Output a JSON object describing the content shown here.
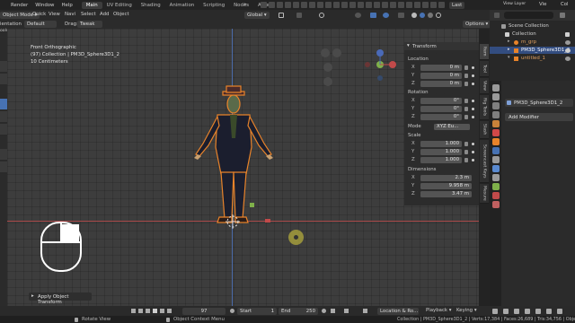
{
  "topbar": {
    "menus": [
      "Render",
      "Window",
      "Help"
    ],
    "workspaces": [
      "Main",
      "UV Editing",
      "Shading",
      "Animation",
      "Scripting",
      "Nodes",
      "Assets"
    ],
    "active_workspace": "Main",
    "right_labels": [
      "Last",
      "View Layer",
      "Vie",
      "Col"
    ]
  },
  "header": {
    "mode": "Object Mode",
    "menus": [
      "Quick",
      "View",
      "Navi",
      "Select",
      "Add",
      "Object"
    ],
    "transform_orientation": "Global",
    "options": "Options",
    "orientation_label": "ientation",
    "orientation_value": "Default",
    "drag_label": "Drag:",
    "drag_value": "Tweak",
    "left_stub": "ools"
  },
  "viewport": {
    "view_name": "Front Orthographic",
    "collection_info": "(97) Collection | PM3D_Sphere3D1_2",
    "scale_info": "10 Centimeters",
    "operator_panel": "Apply Object Transform"
  },
  "npanel": {
    "title": "Transform",
    "location_label": "Location",
    "location": {
      "x": "0 m",
      "y": "0 m",
      "z": "0 m"
    },
    "rotation_label": "Rotation",
    "rotation": {
      "x": "0°",
      "y": "0°",
      "z": "0°"
    },
    "mode_label": "Mode",
    "mode_value": "XYZ Eu...",
    "scale_label": "Scale",
    "scale": {
      "x": "1.000",
      "y": "1.000",
      "z": "1.000"
    },
    "dimensions_label": "Dimensions",
    "dimensions": {
      "x": "2.3 m",
      "y": "9.958 m",
      "z": "3.47 m"
    }
  },
  "sidetabs": [
    "Item",
    "Tool",
    "View",
    "Rig Tools",
    "Slash",
    "Screencast Keys",
    "Mesure"
  ],
  "outliner": {
    "header": "Scene Collection",
    "rows": [
      {
        "label": "Collection",
        "indent": 0
      },
      {
        "label": "m_grp",
        "indent": 2
      },
      {
        "label": "PM3D_Sphere3D1_2",
        "indent": 2,
        "selected": true
      },
      {
        "label": "untitled_1",
        "indent": 2
      }
    ]
  },
  "properties": {
    "object_name": "PM3D_Sphere3D1_2",
    "add_modifier": "Add Modifier"
  },
  "timeline": {
    "current_frame": "97",
    "start_label": "Start",
    "start_value": "1",
    "end_label": "End",
    "end_value": "250",
    "menus": [
      "Location & Ro...",
      "Playback",
      "Keying"
    ]
  },
  "statusbar": {
    "left_hint": "Rotate View",
    "middle_hint": "Object Context Menu",
    "stats": "Collection | PM3D_Sphere3D1_2 | Verts:17,384 | Faces:26,689 | Tris:34,756 | Objects"
  },
  "colors": {
    "accent": "#4772b3",
    "selection": "#334d80",
    "origin_orange": "#e8832a",
    "x_axis": "#c24a4a",
    "y_axis": "#7fb04a"
  }
}
